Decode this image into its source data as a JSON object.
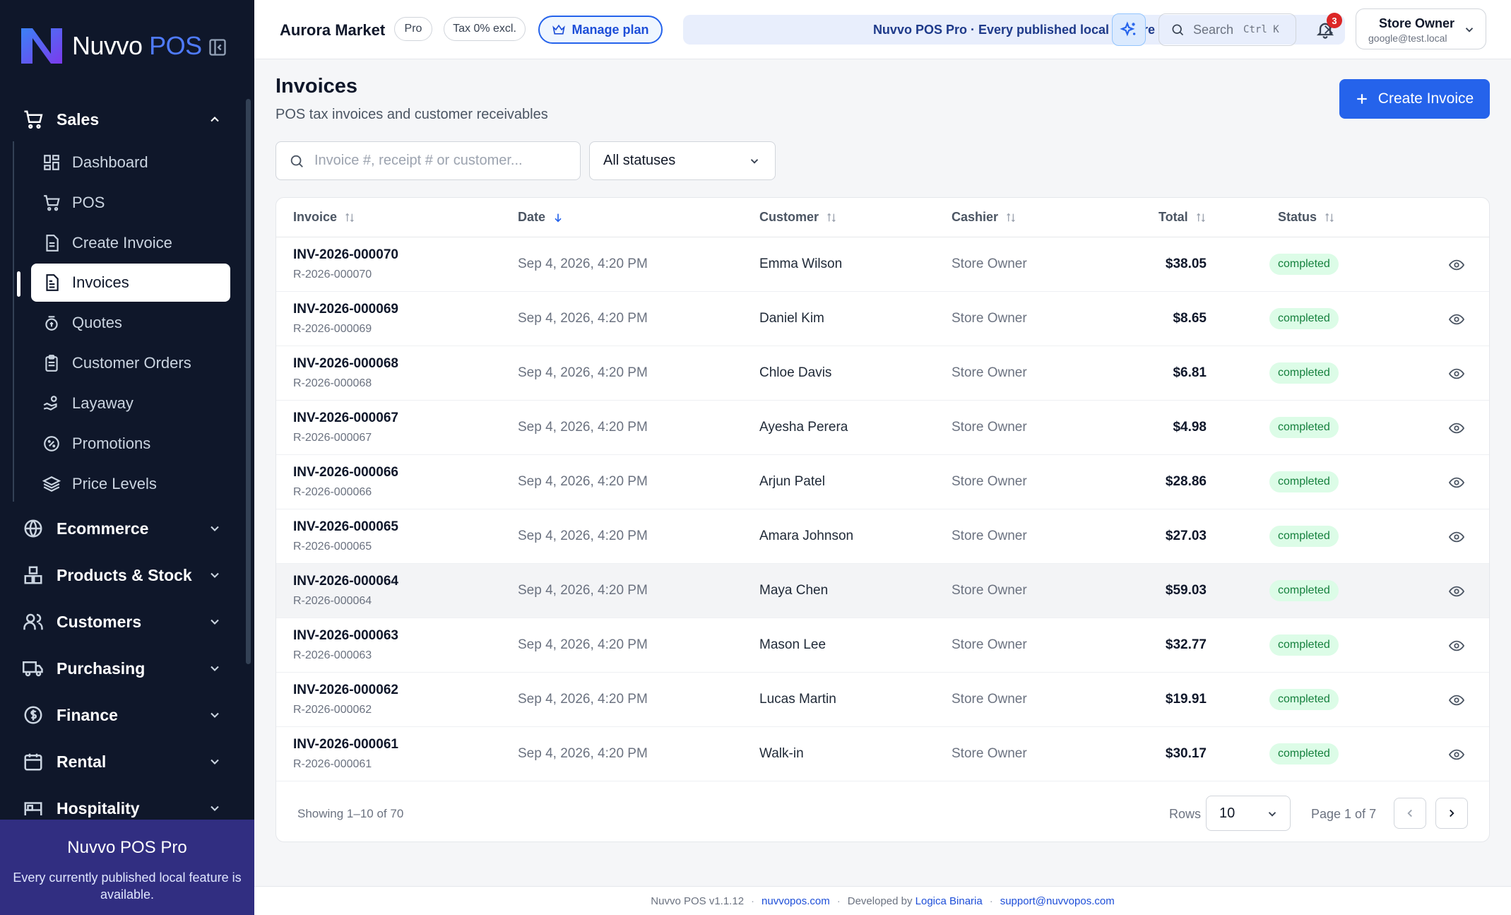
{
  "app": {
    "brand_main": "Nuvvo",
    "brand_accent": "POS",
    "accent_color": "#2563eb"
  },
  "sidebar": {
    "sections": [
      {
        "label": "Sales",
        "icon": "cart-icon",
        "expanded": true
      },
      {
        "label": "Ecommerce",
        "icon": "globe-icon"
      },
      {
        "label": "Products & Stock",
        "icon": "boxes-icon"
      },
      {
        "label": "Customers",
        "icon": "users-icon"
      },
      {
        "label": "Purchasing",
        "icon": "truck-icon"
      },
      {
        "label": "Finance",
        "icon": "dollar-circle-icon"
      },
      {
        "label": "Rental",
        "icon": "calendar-icon"
      },
      {
        "label": "Hospitality",
        "icon": "bed-icon"
      }
    ],
    "sales_items": [
      {
        "label": "Dashboard",
        "icon": "dashboard-icon"
      },
      {
        "label": "POS",
        "icon": "cart-icon"
      },
      {
        "label": "Create Invoice",
        "icon": "file-icon"
      },
      {
        "label": "Invoices",
        "icon": "file-text-icon",
        "active": true
      },
      {
        "label": "Quotes",
        "icon": "coins-icon"
      },
      {
        "label": "Customer Orders",
        "icon": "clipboard-icon"
      },
      {
        "label": "Layaway",
        "icon": "hand-coins-icon"
      },
      {
        "label": "Promotions",
        "icon": "percent-badge-icon"
      },
      {
        "label": "Price Levels",
        "icon": "layers-icon"
      }
    ],
    "promo": {
      "title": "Nuvvo POS Pro",
      "desc": "Every currently published local feature is available."
    }
  },
  "topbar": {
    "store_name": "Aurora Market",
    "plan_chip": "Pro",
    "tax_chip": "Tax 0% excl.",
    "manage_label": "Manage plan",
    "banner_text": "Nuvvo POS Pro · Every published local feature",
    "search_label": "Search",
    "search_kbd": "Ctrl K",
    "notif_count": "3",
    "user_name": "Store Owner",
    "user_email": "google@test.local"
  },
  "page": {
    "title": "Invoices",
    "subtitle": "POS tax invoices and customer receivables",
    "create_label": "Create Invoice",
    "search_placeholder": "Invoice #, receipt # or customer...",
    "status_filter": "All statuses"
  },
  "table": {
    "columns": [
      "Invoice",
      "Date",
      "Customer",
      "Cashier",
      "Total",
      "Status"
    ],
    "rows": [
      {
        "invoice": "INV-2026-000070",
        "receipt": "R-2026-000070",
        "date": "Sep 4, 2026, 4:20 PM",
        "customer": "Emma Wilson",
        "cashier": "Store Owner",
        "total": "$38.05",
        "status": "completed"
      },
      {
        "invoice": "INV-2026-000069",
        "receipt": "R-2026-000069",
        "date": "Sep 4, 2026, 4:20 PM",
        "customer": "Daniel Kim",
        "cashier": "Store Owner",
        "total": "$8.65",
        "status": "completed"
      },
      {
        "invoice": "INV-2026-000068",
        "receipt": "R-2026-000068",
        "date": "Sep 4, 2026, 4:20 PM",
        "customer": "Chloe Davis",
        "cashier": "Store Owner",
        "total": "$6.81",
        "status": "completed"
      },
      {
        "invoice": "INV-2026-000067",
        "receipt": "R-2026-000067",
        "date": "Sep 4, 2026, 4:20 PM",
        "customer": "Ayesha Perera",
        "cashier": "Store Owner",
        "total": "$4.98",
        "status": "completed"
      },
      {
        "invoice": "INV-2026-000066",
        "receipt": "R-2026-000066",
        "date": "Sep 4, 2026, 4:20 PM",
        "customer": "Arjun Patel",
        "cashier": "Store Owner",
        "total": "$28.86",
        "status": "completed"
      },
      {
        "invoice": "INV-2026-000065",
        "receipt": "R-2026-000065",
        "date": "Sep 4, 2026, 4:20 PM",
        "customer": "Amara Johnson",
        "cashier": "Store Owner",
        "total": "$27.03",
        "status": "completed"
      },
      {
        "invoice": "INV-2026-000064",
        "receipt": "R-2026-000064",
        "date": "Sep 4, 2026, 4:20 PM",
        "customer": "Maya Chen",
        "cashier": "Store Owner",
        "total": "$59.03",
        "status": "completed",
        "highlighted": true
      },
      {
        "invoice": "INV-2026-000063",
        "receipt": "R-2026-000063",
        "date": "Sep 4, 2026, 4:20 PM",
        "customer": "Mason Lee",
        "cashier": "Store Owner",
        "total": "$32.77",
        "status": "completed"
      },
      {
        "invoice": "INV-2026-000062",
        "receipt": "R-2026-000062",
        "date": "Sep 4, 2026, 4:20 PM",
        "customer": "Lucas Martin",
        "cashier": "Store Owner",
        "total": "$19.91",
        "status": "completed"
      },
      {
        "invoice": "INV-2026-000061",
        "receipt": "R-2026-000061",
        "date": "Sep 4, 2026, 4:20 PM",
        "customer": "Walk-in",
        "cashier": "Store Owner",
        "total": "$30.17",
        "status": "completed"
      }
    ],
    "showing": "Showing 1–10 of 70",
    "rows_label": "Rows",
    "rows_value": "10",
    "page_label": "Page 1 of 7"
  },
  "footer": {
    "version": "Nuvvo POS v1.1.12",
    "site": "nuvvopos.com",
    "dev_prefix": "Developed by",
    "dev_name": "Logica Binaria",
    "support": "support@nuvvopos.com"
  }
}
